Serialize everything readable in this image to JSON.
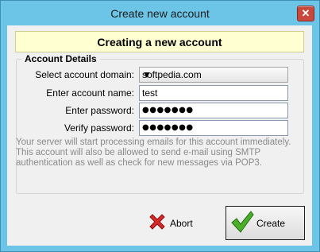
{
  "window": {
    "title": "Create new account"
  },
  "banner": {
    "text": "Creating a new account"
  },
  "account_details": {
    "group_title": "Account Details",
    "domain_label": "Select account domain:",
    "domain_value": "softpedia.com",
    "name_label": "Enter account name:",
    "name_value": "test",
    "password_label": "Enter password:",
    "password_value": "●●●●●●●",
    "verify_label": "Verify password:",
    "verify_value": "●●●●●●●"
  },
  "description": "Your server will start processing emails for this account immediately. This account will also be allowed to send e-mail using SMTP authentication as well as check for new messages via POP3.",
  "buttons": {
    "abort": "Abort",
    "create": "Create"
  },
  "icons": {
    "close": "close-icon",
    "dropdown": "chevron-down-icon",
    "abort": "red-x-icon",
    "create": "green-check-icon"
  },
  "colors": {
    "frame": "#6cc4e6",
    "banner_bg": "#ffffd2",
    "close": "#c9483c",
    "abort_icon": "#d42a2a",
    "create_icon": "#4caf28"
  }
}
